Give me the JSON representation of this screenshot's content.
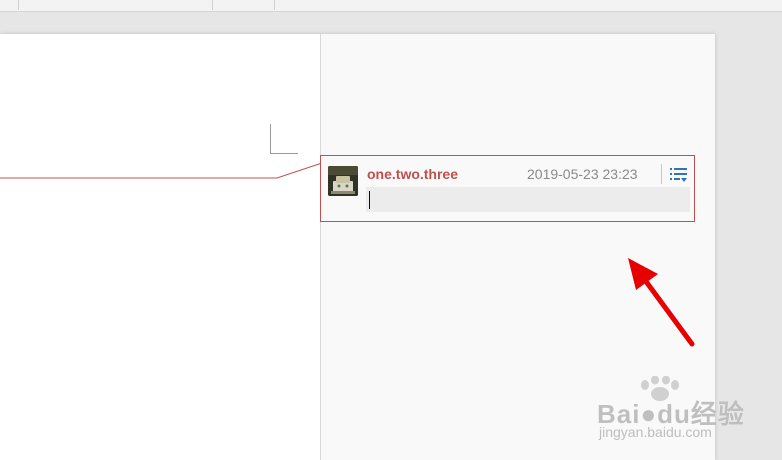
{
  "comment": {
    "author": "one.two.three",
    "timestamp": "2019-05-23 23:23",
    "reply_value": "",
    "menu_icon": "list-menu-icon",
    "avatar_icon": "user-avatar"
  },
  "colors": {
    "accent": "#c0504d",
    "arrow": "#e60000",
    "menu_icon": "#2e75b6"
  },
  "watermark": {
    "brand": "Bai●du经验",
    "url": "jingyan.baidu.com"
  }
}
